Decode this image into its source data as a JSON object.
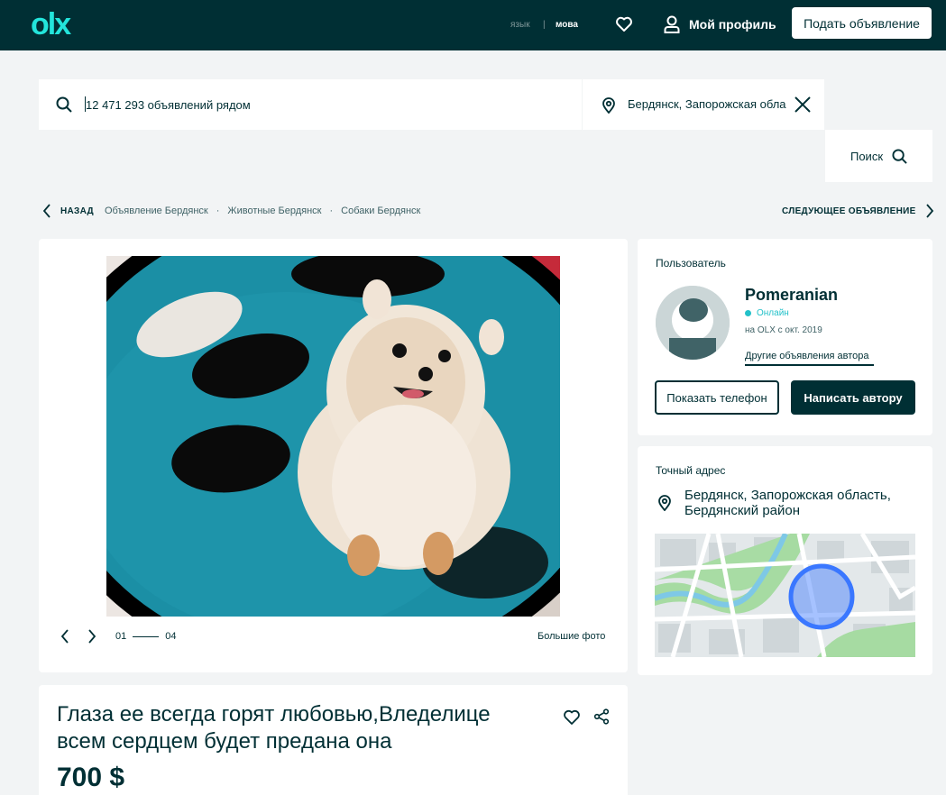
{
  "header": {
    "logo_text": "olx",
    "lang_ru": "язык",
    "lang_separator": "|",
    "lang_ua": "мова",
    "profile_label": "Мой профиль",
    "post_button": "Подать объявление"
  },
  "search": {
    "placeholder": "12 471 293 объявлений рядом",
    "location": "Бердянск, Запорожская обла",
    "button_label": "Поиск"
  },
  "breadcrumbs": {
    "back_label": "НАЗАД",
    "separator": "·",
    "items": [
      "Объявление Бердянск",
      "Животные Бердянск",
      "Собаки Бердянск"
    ],
    "next_label": "СЛЕДУЮЩЕЕ ОБЪЯВЛЕНИЕ"
  },
  "gallery": {
    "current": "01",
    "total": "04",
    "big_photo_label": "Большие фото"
  },
  "ad": {
    "title": "Глаза ее всегда горят любовью,Вледелице всем сердцем будет предана она",
    "price": "700 $"
  },
  "user": {
    "section_label": "Пользователь",
    "name": "Pomeranian",
    "status": "Онлайн",
    "member_since": "на OLX с окт. 2019",
    "other_ads_link": "Другие объявления автора",
    "phone_button": "Показать телефон",
    "write_button": "Написать автору"
  },
  "address": {
    "section_label": "Точный адрес",
    "text": "Бердянск, Запорожская область, Бердянский район"
  },
  "colors": {
    "brand_dark": "#002f34",
    "brand_accent": "#23e5db",
    "online": "#23c1c9",
    "map_marker": "#3a77ff",
    "background": "#f2f4f5"
  },
  "icons": [
    "search-icon",
    "pin-icon",
    "close-icon",
    "heart-icon",
    "user-icon",
    "chevron-left-icon",
    "chevron-right-icon",
    "share-icon"
  ]
}
